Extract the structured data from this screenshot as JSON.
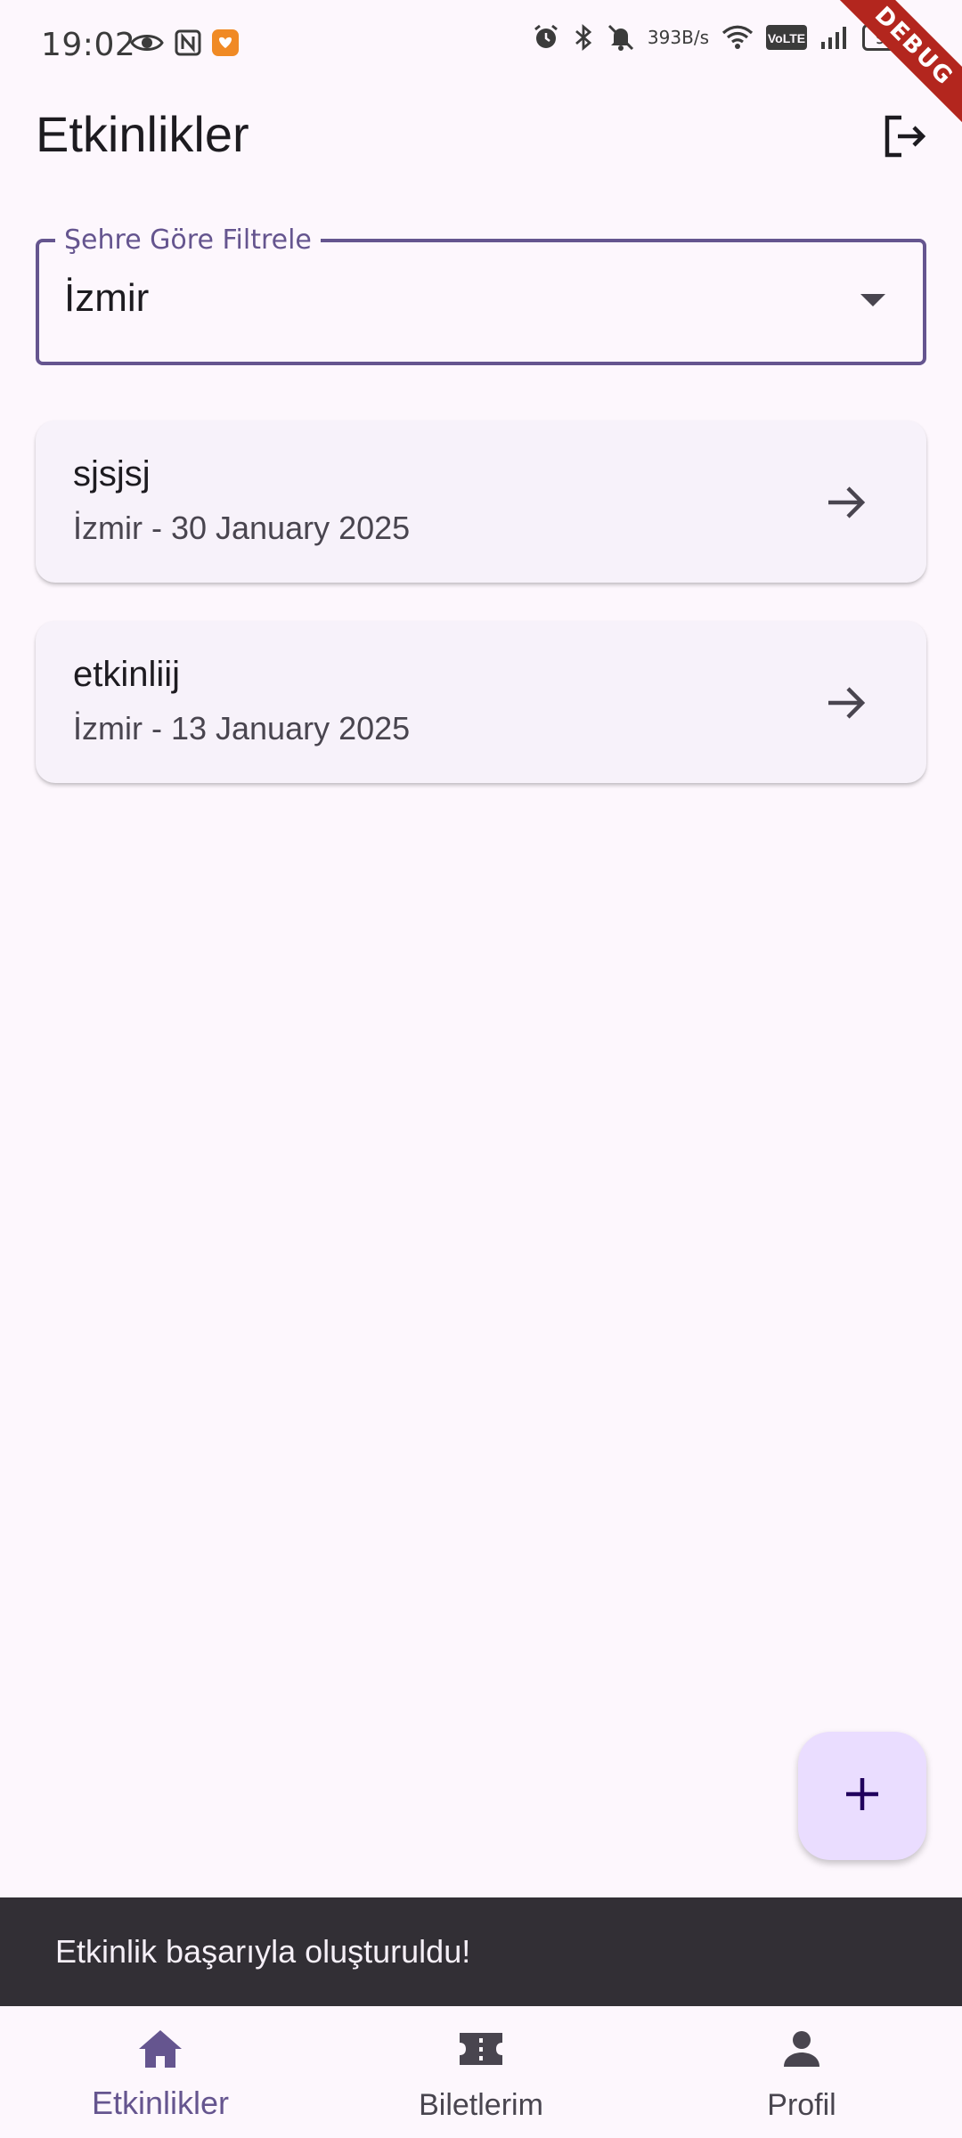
{
  "status_bar": {
    "time": "19:02",
    "net_speed_value": "393",
    "net_speed_unit": "B/s",
    "network_type": "VoLTE",
    "battery": "97",
    "left_icons": [
      "eye-icon",
      "nfc-icon",
      "shield-app-icon"
    ],
    "right_icons": [
      "alarm-icon",
      "bluetooth-icon",
      "mute-icon",
      "wifi-icon",
      "volte-icon",
      "signal-icon",
      "battery-icon"
    ]
  },
  "debug_banner": "DEBUG",
  "app_bar": {
    "title": "Etkinlikler",
    "action_icon": "logout-icon"
  },
  "filter": {
    "label": "Şehre Göre Filtrele",
    "selected": "İzmir"
  },
  "events": [
    {
      "title": "sjsjsj",
      "subtitle": "İzmir - 30 January 2025"
    },
    {
      "title": "etkinliij",
      "subtitle": "İzmir - 13 January 2025"
    }
  ],
  "fab": {
    "icon": "add-icon"
  },
  "snackbar": {
    "message": "Etkinlik başarıyla oluşturuldu!"
  },
  "bottom_nav": {
    "items": [
      {
        "label": "Etkinlikler",
        "icon": "home-icon",
        "active": true
      },
      {
        "label": "Biletlerim",
        "icon": "ticket-icon",
        "active": false
      },
      {
        "label": "Profil",
        "icon": "person-icon",
        "active": false
      }
    ]
  },
  "colors": {
    "primary": "#65558f",
    "background": "#fdf7fd",
    "card": "#f7f2fa",
    "fab": "#eaddff",
    "snackbar": "#322f35",
    "debug": "#b3261e"
  }
}
